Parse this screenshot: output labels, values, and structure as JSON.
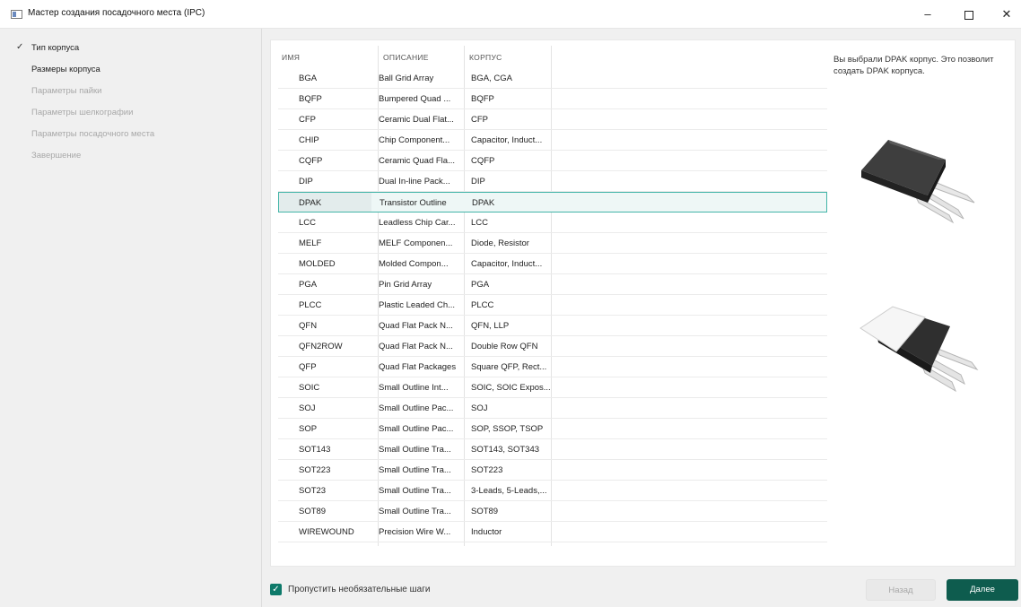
{
  "window": {
    "title": "Мастер создания посадочного места (IPC)",
    "minimize_glyph": "–",
    "close_glyph": "✕"
  },
  "sidebar": {
    "steps": [
      {
        "label": "Тип корпуса",
        "state": "done"
      },
      {
        "label": "Размеры корпуса",
        "state": "active"
      },
      {
        "label": "Параметры пайки",
        "state": "disabled"
      },
      {
        "label": "Параметры шелкографии",
        "state": "disabled"
      },
      {
        "label": "Параметры посадочного места",
        "state": "disabled"
      },
      {
        "label": "Завершение",
        "state": "disabled"
      }
    ],
    "check_glyph": "✓"
  },
  "table": {
    "columns": [
      "ИМЯ",
      "ОПИСАНИЕ",
      "КОРПУС"
    ],
    "rows": [
      {
        "name": "BGA",
        "description": "Ball Grid Array",
        "package": "BGA, CGA"
      },
      {
        "name": "BQFP",
        "description": "Bumpered Quad ...",
        "package": "BQFP"
      },
      {
        "name": "CFP",
        "description": "Ceramic Dual Flat...",
        "package": "CFP"
      },
      {
        "name": "CHIP",
        "description": "Chip Component...",
        "package": "Capacitor, Induct..."
      },
      {
        "name": "CQFP",
        "description": "Ceramic Quad Fla...",
        "package": "CQFP"
      },
      {
        "name": "DIP",
        "description": "Dual In-line Pack...",
        "package": "DIP"
      },
      {
        "name": "DPAK",
        "description": "Transistor Outline",
        "package": "DPAK"
      },
      {
        "name": "LCC",
        "description": "Leadless Chip Car...",
        "package": "LCC"
      },
      {
        "name": "MELF",
        "description": "MELF Componen...",
        "package": "Diode, Resistor"
      },
      {
        "name": "MOLDED",
        "description": "Molded Compon...",
        "package": "Capacitor, Induct..."
      },
      {
        "name": "PGA",
        "description": "Pin Grid Array",
        "package": "PGA"
      },
      {
        "name": "PLCC",
        "description": "Plastic Leaded Ch...",
        "package": "PLCC"
      },
      {
        "name": "QFN",
        "description": "Quad Flat Pack N...",
        "package": "QFN, LLP"
      },
      {
        "name": "QFN2ROW",
        "description": "Quad Flat Pack N...",
        "package": "Double Row QFN"
      },
      {
        "name": "QFP",
        "description": "Quad Flat Packages",
        "package": "Square QFP, Rect..."
      },
      {
        "name": "SOIC",
        "description": "Small Outline Int...",
        "package": "SOIC, SOIC Expos..."
      },
      {
        "name": "SOJ",
        "description": "Small Outline Pac...",
        "package": "SOJ"
      },
      {
        "name": "SOP",
        "description": "Small Outline Pac...",
        "package": "SOP, SSOP, TSOP"
      },
      {
        "name": "SOT143",
        "description": "Small Outline Tra...",
        "package": "SOT143, SOT343"
      },
      {
        "name": "SOT223",
        "description": "Small Outline Tra...",
        "package": "SOT223"
      },
      {
        "name": "SOT23",
        "description": "Small Outline Tra...",
        "package": "3-Leads, 5-Leads,..."
      },
      {
        "name": "SOT89",
        "description": "Small Outline Tra...",
        "package": "SOT89"
      },
      {
        "name": "WIREWOUND",
        "description": "Precision Wire W...",
        "package": "Inductor"
      }
    ],
    "selected_index": 6
  },
  "info": {
    "text": "Вы выбрали DPAK корпус. Это позволит создать DPAK корпуса."
  },
  "footer": {
    "skip_label": "Пропустить необязательные шаги",
    "skip_checked": true,
    "back_label": "Назад",
    "next_label": "Далее"
  },
  "colors": {
    "accent": "#0e5c4e",
    "selection_border": "#43b5a8"
  }
}
